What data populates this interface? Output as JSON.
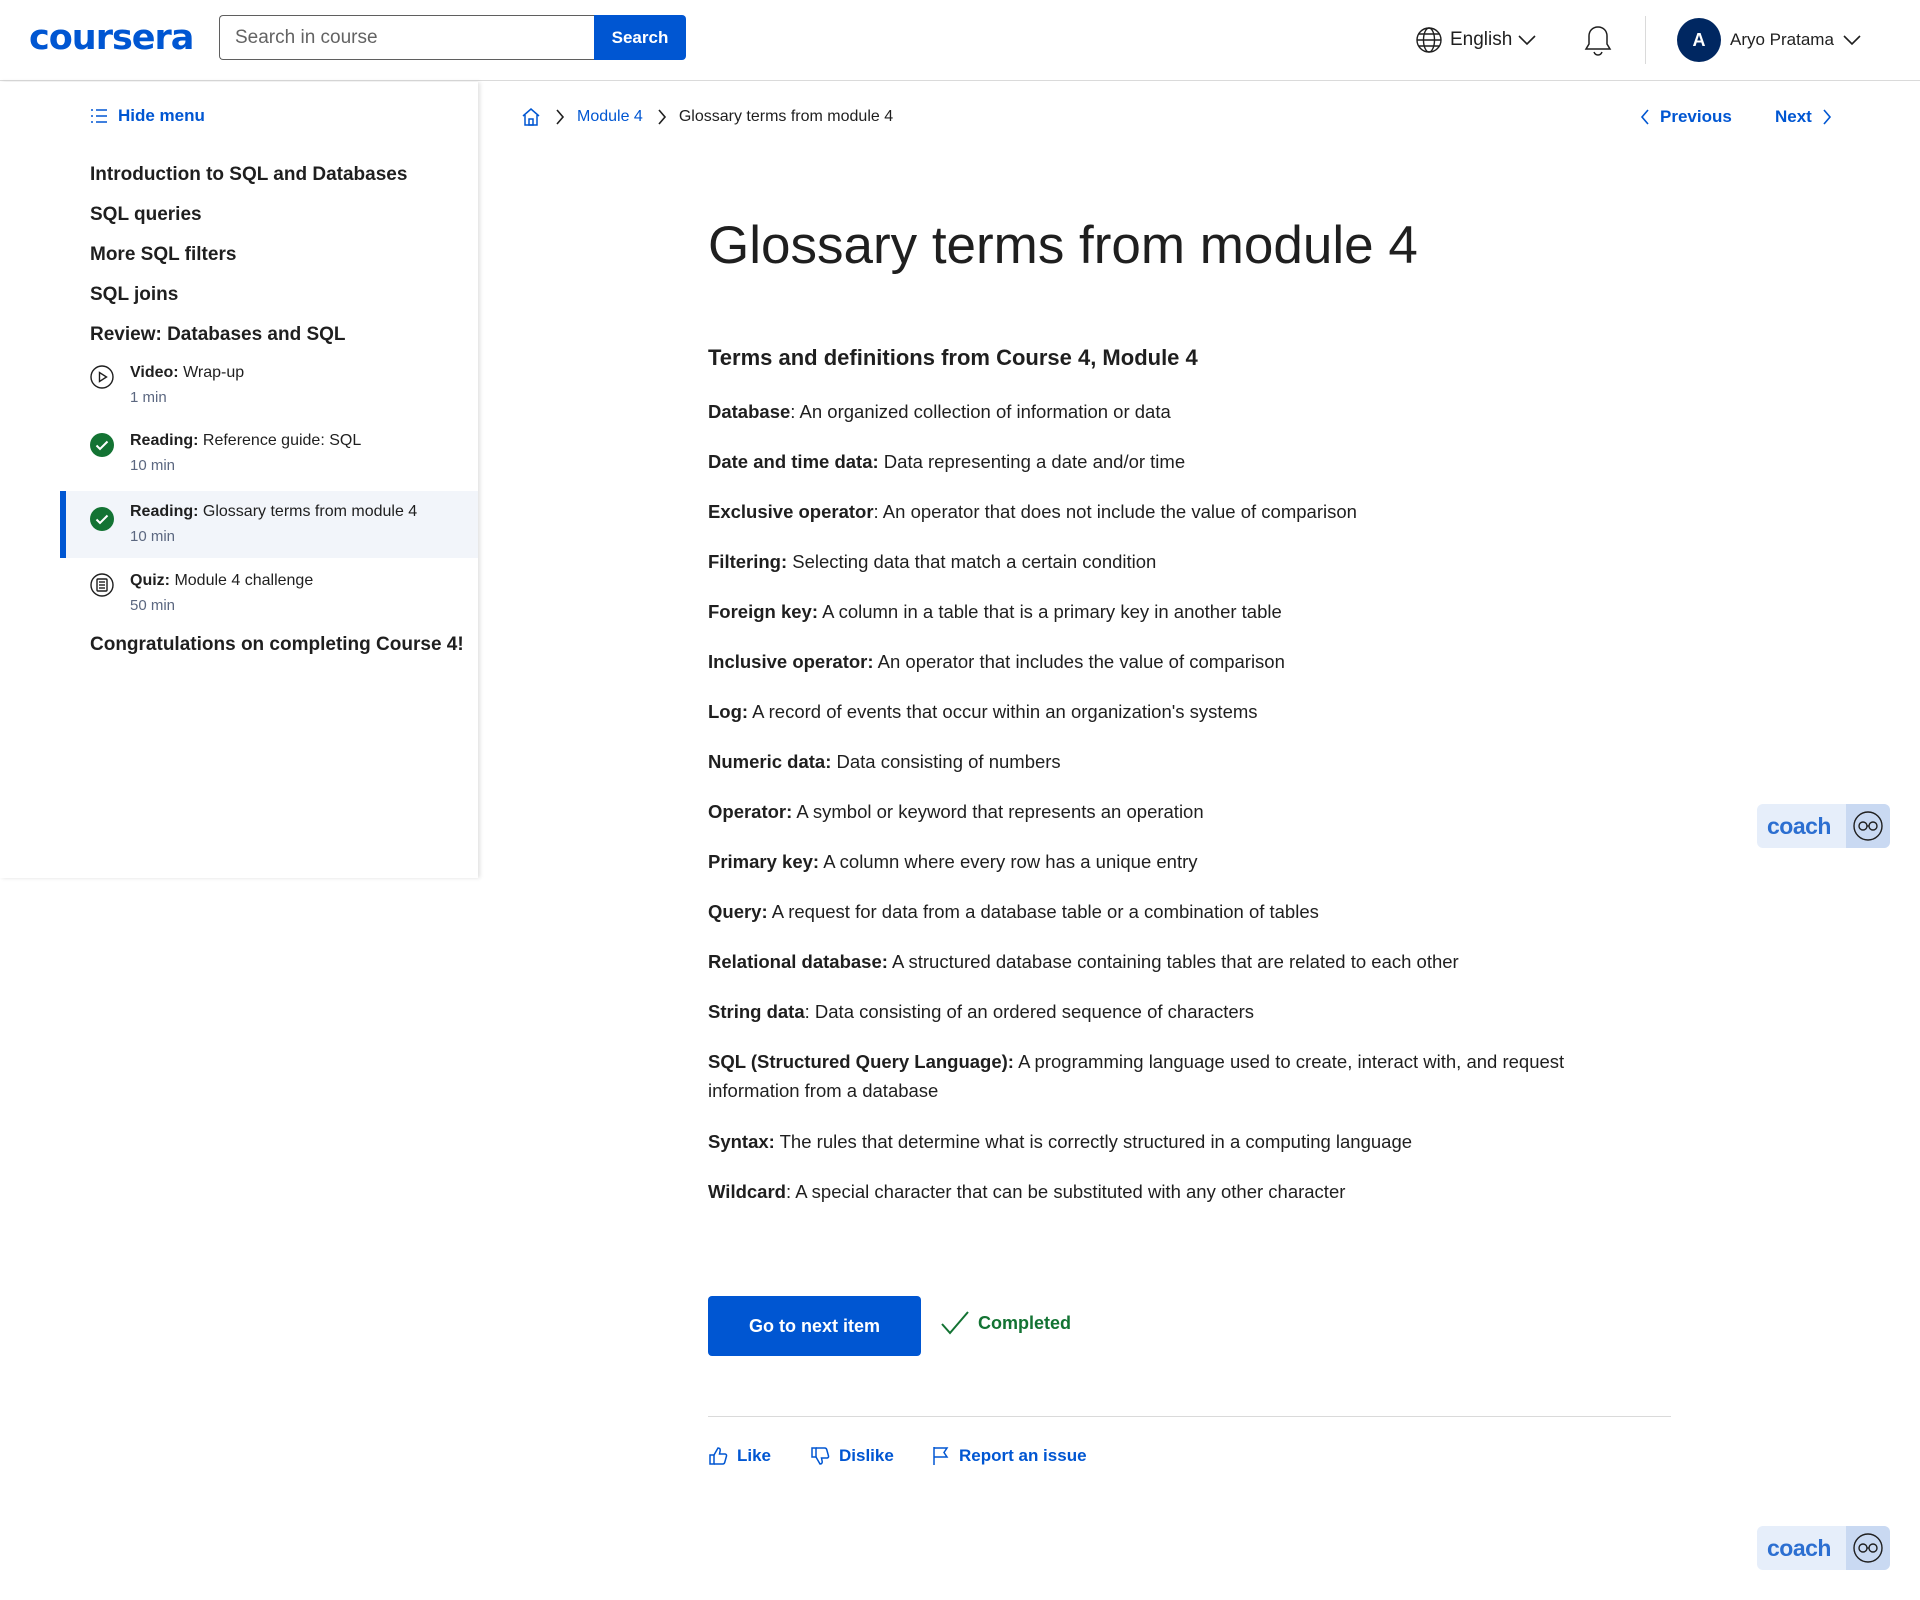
{
  "header": {
    "logo": "coursera",
    "search_placeholder": "Search in course",
    "search_button": "Search",
    "language": "English",
    "avatar_initial": "A",
    "user_name": "Aryo Pratama"
  },
  "sidebar": {
    "hide_menu": "Hide menu",
    "modules": [
      "Introduction to SQL and Databases",
      "SQL queries",
      "More SQL filters",
      "SQL joins",
      "Review: Databases and SQL"
    ],
    "items": [
      {
        "type": "Video:",
        "name": "Wrap-up",
        "duration": "1 min",
        "icon": "play-icon"
      },
      {
        "type": "Reading:",
        "name": "Reference guide: SQL",
        "duration": "10 min",
        "icon": "completed-check-icon"
      },
      {
        "type": "Reading:",
        "name": "Glossary terms from module 4",
        "duration": "10 min",
        "icon": "completed-check-icon"
      },
      {
        "type": "Quiz:",
        "name": "Module 4 challenge",
        "duration": "50 min",
        "icon": "quiz-icon"
      }
    ],
    "last_module": "Congratulations on completing Course 4!"
  },
  "breadcrumb": {
    "module": "Module 4",
    "current": "Glossary terms from module 4"
  },
  "nav": {
    "previous": "Previous",
    "next": "Next"
  },
  "main": {
    "title": "Glossary terms from module 4",
    "subtitle": "Terms and definitions from Course 4, Module 4",
    "terms": [
      {
        "term": "Database",
        "def": ": An organized collection of information or data"
      },
      {
        "term": "Date and time data:",
        "def": " Data representing a date and/or time"
      },
      {
        "term": "Exclusive operator",
        "def": ": An operator that does not include the value of comparison"
      },
      {
        "term": "Filtering:",
        "def": " Selecting data that match a certain condition"
      },
      {
        "term": "Foreign key:",
        "def": " A column in a table that is a primary key in another table"
      },
      {
        "term": "Inclusive operator:",
        "def": " An operator that includes the value of comparison"
      },
      {
        "term": "Log:",
        "def": " A record of events that occur within an organization's systems"
      },
      {
        "term": "Numeric data:",
        "def": " Data consisting of numbers"
      },
      {
        "term": "Operator:",
        "def": " A symbol or keyword that represents an operation"
      },
      {
        "term": "Primary key:",
        "def": " A column where every row has a unique entry"
      },
      {
        "term": "Query:",
        "def": " A request for data from a database table or a combination of tables"
      },
      {
        "term": "Relational database:",
        "def": " A structured database containing tables that are related to each other"
      },
      {
        "term": "String data",
        "def": ": Data consisting of an ordered sequence of characters"
      },
      {
        "term": "SQL (Structured Query Language):",
        "def": " A programming language used to create, interact with, and request information from a database"
      },
      {
        "term": "Syntax:",
        "def": " The rules that determine what is correctly structured in a computing language"
      },
      {
        "term": "Wildcard",
        "def": ": A special character that can be substituted with any other character"
      }
    ],
    "next_item_button": "Go to next item",
    "completed_label": "Completed"
  },
  "feedback": {
    "like": "Like",
    "dislike": "Dislike",
    "report": "Report an issue"
  },
  "coach": {
    "label": "coach"
  },
  "colors": {
    "brand": "#0056d2",
    "completed": "#137333",
    "active_bg": "#f2f5fa"
  }
}
